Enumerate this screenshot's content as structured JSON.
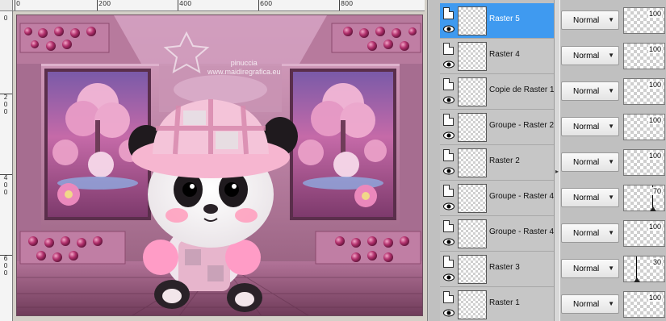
{
  "ruler": {
    "top_labels": [
      "0",
      "200",
      "400",
      "600",
      "800"
    ],
    "left_labels": [
      "0",
      "2\n0\n0",
      "4\n0\n0",
      "6\n0\n0"
    ]
  },
  "canvas": {
    "watermark": "pinuccia\nwww.maidiregrafica.eu"
  },
  "layers": [
    {
      "name": "Raster 5",
      "blend": "Normal",
      "opacity": 100,
      "selected": true
    },
    {
      "name": "Raster 4",
      "blend": "Normal",
      "opacity": 100,
      "selected": false
    },
    {
      "name": "Copie de Raster 1",
      "blend": "Normal",
      "opacity": 100,
      "selected": false
    },
    {
      "name": "Groupe - Raster 2",
      "blend": "Normal",
      "opacity": 100,
      "selected": false
    },
    {
      "name": "Raster 2",
      "blend": "Normal",
      "opacity": 100,
      "selected": false
    },
    {
      "name": "Groupe - Raster 4",
      "blend": "Normal",
      "opacity": 70,
      "selected": false
    },
    {
      "name": "Groupe - Raster 4",
      "blend": "Normal",
      "opacity": 100,
      "selected": false
    },
    {
      "name": "Raster 3",
      "blend": "Normal",
      "opacity": 30,
      "selected": false
    },
    {
      "name": "Raster 1",
      "blend": "Normal",
      "opacity": 100,
      "selected": false
    }
  ],
  "icons": {
    "visibility": "eye-icon",
    "layer_type": "raster-layer-icon",
    "dropdown": "dropdown-arrow-icon",
    "splitter": "splitter-arrow-icon"
  },
  "colors": {
    "selection": "#3f9af0",
    "canvas_pink": "#c98fb0",
    "panel_bg": "#c6c6c6"
  }
}
